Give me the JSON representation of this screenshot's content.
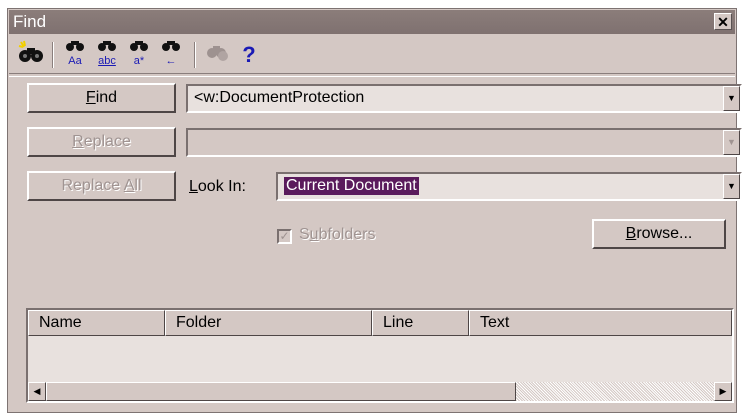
{
  "window": {
    "title": "Find",
    "close_label": "✕"
  },
  "toolbar": {
    "buttons": [
      {
        "icon": "find-binoculars-icon"
      },
      {
        "icon": "match-case-icon",
        "caption": "Aa"
      },
      {
        "icon": "whole-word-icon",
        "caption": "abc"
      },
      {
        "icon": "wildcard-icon",
        "caption": "a*"
      },
      {
        "icon": "find-previous-icon",
        "caption": "←"
      },
      {
        "icon": "disabled-tool-icon"
      },
      {
        "icon": "help-icon",
        "label": "?"
      }
    ]
  },
  "find": {
    "button_label_prefix": "",
    "button_mnemonic": "F",
    "button_label_rest": "ind",
    "value": "<w:DocumentProtection"
  },
  "replace": {
    "button_mnemonic": "R",
    "button_label_rest": "eplace",
    "value": ""
  },
  "replace_all": {
    "label_start": "Replace ",
    "mnemonic": "A",
    "label_end": "ll"
  },
  "look_in": {
    "mnemonic": "L",
    "label_rest": "ook In:",
    "value": "Current Document"
  },
  "subfolders": {
    "label_start": "S",
    "mnemonic": "u",
    "label_end": "bfolders",
    "checked": true
  },
  "browse": {
    "mnemonic": "B",
    "label_rest": "rowse..."
  },
  "results": {
    "columns": [
      "Name",
      "Folder",
      "Line",
      "Text"
    ]
  },
  "colors": {
    "face": "#d4c8c4",
    "titlebar": "#837574",
    "selection": "#5a1b5c",
    "field": "#e8e1de"
  }
}
